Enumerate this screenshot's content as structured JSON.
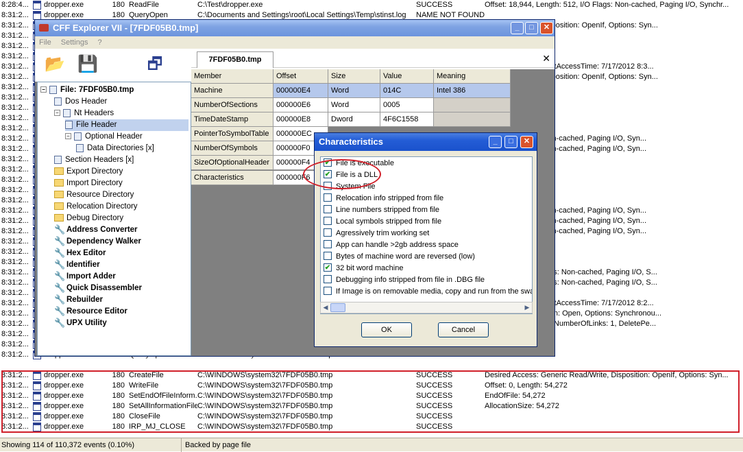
{
  "procmon": {
    "bg_rows": [
      {
        "time": "8:28:4...",
        "proc": "dropper.exe",
        "pid": "180",
        "op": "ReadFile",
        "path": "C:\\Test\\dropper.exe",
        "res": "SUCCESS",
        "det": "Offset: 18,944, Length: 512, I/O Flags: Non-cached, Paging I/O, Synchr..."
      },
      {
        "time": "8:31:2...",
        "proc": "dropper.exe",
        "pid": "180",
        "op": "QueryOpen",
        "path": "C:\\Documents and Settings\\root\\Local Settings\\Temp\\stinst.log",
        "res": "NAME NOT FOUND",
        "det": ""
      },
      {
        "time": "8:31:2...",
        "det": "eric Read/Write, Disposition: OpenIf, Options: Syn..."
      },
      {
        "time": "8:31:2...",
        "det": ""
      },
      {
        "time": "8:31:2...",
        "det": ""
      },
      {
        "time": "8:31:2...",
        "det": ""
      },
      {
        "time": "8:31:2...",
        "det": "012 8:31:28 PM, LastAccessTime: 7/17/2012 8:3..."
      },
      {
        "time": "8:31:2...",
        "det": "eric Read/Write, Disposition: OpenIf, Options: Syn..."
      },
      {
        "time": "8:31:2...",
        "det": ""
      },
      {
        "time": "8:31:2...",
        "det": ""
      },
      {
        "time": "8:31:2...",
        "det": ""
      },
      {
        "time": "8:31:2...",
        "det": ""
      },
      {
        "time": "8:31:2...",
        "det": ""
      },
      {
        "time": "8:31:2...",
        "det": "4,096, I/O Flags: Non-cached, Paging I/O, Syn..."
      },
      {
        "time": "8:31:2...",
        "det": "4,096, I/O Flags: Non-cached, Paging I/O, Syn..."
      },
      {
        "time": "8:31:2...",
        "det": ""
      },
      {
        "time": "8:31:2...",
        "det": ""
      },
      {
        "time": "8:31:2...",
        "det": ""
      },
      {
        "time": "8:31:2...",
        "det": ""
      },
      {
        "time": "8:31:2...",
        "det": ""
      },
      {
        "time": "8:31:2...",
        "det": "4,096, I/O Flags: Non-cached, Paging I/O, Syn..."
      },
      {
        "time": "8:31:2...",
        "det": "4,096, I/O Flags: Non-cached, Paging I/O, Syn..."
      },
      {
        "time": "8:31:2...",
        "det": "4,096, I/O Flags: Non-cached, Paging I/O, Syn..."
      },
      {
        "time": "8:31:2...",
        "det": ""
      },
      {
        "time": "8:31:2...",
        "det": ""
      },
      {
        "time": "8:31:2...",
        "det": ""
      },
      {
        "time": "8:31:2...",
        "det": "ngth: 4,096, I/O Flags: Non-cached, Paging I/O, S..."
      },
      {
        "time": "8:31:2...",
        "det": "ngth: 4,096, I/O Flags: Non-cached, Paging I/O, S..."
      },
      {
        "time": "8:31:2...",
        "det": ""
      },
      {
        "time": "8:31:2...",
        "det": "012 8:26:13 PM, LastAccessTime: 7/17/2012 8:2..."
      },
      {
        "time": "8:31:2...",
        "det": "eric Read, Disposition: Open, Options: Synchronou..."
      },
      {
        "time": "8:31:2...",
        "det": ", EndOfFile: 54,272, NumberOfLinks: 1, DeletePe..."
      },
      {
        "time": "8:31:2...",
        "det": "272"
      },
      {
        "time": "8:31:2...",
        "det": ""
      },
      {
        "time": "8:31:2...",
        "proc": "dropper.exe",
        "pid": "180",
        "op": "QueryOpen",
        "path": "C:\\WINDOWS\\system32\\7FDF05B0.tmp",
        "res": "NAME NOT FOUND",
        "det": ""
      }
    ],
    "red_rows": [
      {
        "time": "8:31:2...",
        "proc": "dropper.exe",
        "pid": "180",
        "op": "CreateFile",
        "path": "C:\\WINDOWS\\system32\\7FDF05B0.tmp",
        "res": "SUCCESS",
        "det": "Desired Access: Generic Read/Write, Disposition: OpenIf, Options: Syn..."
      },
      {
        "time": "8:31:2...",
        "proc": "dropper.exe",
        "pid": "180",
        "op": "WriteFile",
        "path": "C:\\WINDOWS\\system32\\7FDF05B0.tmp",
        "res": "SUCCESS",
        "det": "Offset: 0, Length: 54,272"
      },
      {
        "time": "8:31:2...",
        "proc": "dropper.exe",
        "pid": "180",
        "op": "SetEndOfFileInform...",
        "path": "C:\\WINDOWS\\system32\\7FDF05B0.tmp",
        "res": "SUCCESS",
        "det": "EndOfFile: 54,272"
      },
      {
        "time": "8:31:2...",
        "proc": "dropper.exe",
        "pid": "180",
        "op": "SetAllInformationFile",
        "path": "C:\\WINDOWS\\system32\\7FDF05B0.tmp",
        "res": "SUCCESS",
        "det": "AllocationSize: 54,272"
      },
      {
        "time": "8:31:2...",
        "proc": "dropper.exe",
        "pid": "180",
        "op": "CloseFile",
        "path": "C:\\WINDOWS\\system32\\7FDF05B0.tmp",
        "res": "SUCCESS",
        "det": ""
      },
      {
        "time": "8:31:2...",
        "proc": "dropper.exe",
        "pid": "180",
        "op": "IRP_MJ_CLOSE",
        "path": "C:\\WINDOWS\\system32\\7FDF05B0.tmp",
        "res": "SUCCESS",
        "det": ""
      }
    ],
    "status_left": "Showing 114 of 110,372 events (0.10%)",
    "status_right": "Backed by page file"
  },
  "cff": {
    "title": "CFF Explorer VII - [7FDF05B0.tmp]",
    "menu": [
      "File",
      "Settings",
      "?"
    ],
    "tab_label": "7FDF05B0.tmp",
    "tree": [
      {
        "label": "File: 7FDF05B0.tmp",
        "kind": "root"
      },
      {
        "label": "Dos Header",
        "kind": "doc"
      },
      {
        "label": "Nt Headers",
        "kind": "doc"
      },
      {
        "label": "File Header",
        "kind": "doc"
      },
      {
        "label": "Optional Header",
        "kind": "doc"
      },
      {
        "label": "Data Directories [x]",
        "kind": "doc"
      },
      {
        "label": "Section Headers [x]",
        "kind": "doc"
      },
      {
        "label": "Export Directory",
        "kind": "folder"
      },
      {
        "label": "Import Directory",
        "kind": "folder"
      },
      {
        "label": "Resource Directory",
        "kind": "folder"
      },
      {
        "label": "Relocation Directory",
        "kind": "folder"
      },
      {
        "label": "Debug Directory",
        "kind": "folder"
      },
      {
        "label": "Address Converter",
        "kind": "tool"
      },
      {
        "label": "Dependency Walker",
        "kind": "tool"
      },
      {
        "label": "Hex Editor",
        "kind": "tool"
      },
      {
        "label": "Identifier",
        "kind": "tool"
      },
      {
        "label": "Import Adder",
        "kind": "tool"
      },
      {
        "label": "Quick Disassembler",
        "kind": "tool"
      },
      {
        "label": "Rebuilder",
        "kind": "tool"
      },
      {
        "label": "Resource Editor",
        "kind": "tool"
      },
      {
        "label": "UPX Utility",
        "kind": "tool"
      }
    ],
    "grid_headers": [
      "Member",
      "Offset",
      "Size",
      "Value",
      "Meaning"
    ],
    "grid_rows": [
      [
        "Machine",
        "000000E4",
        "Word",
        "014C",
        "Intel 386"
      ],
      [
        "NumberOfSections",
        "000000E6",
        "Word",
        "0005",
        ""
      ],
      [
        "TimeDateStamp",
        "000000E8",
        "Dword",
        "4F6C1558",
        ""
      ],
      [
        "PointerToSymbolTable",
        "000000EC",
        "",
        "",
        ""
      ],
      [
        "NumberOfSymbols",
        "000000F0",
        "",
        "",
        ""
      ],
      [
        "SizeOfOptionalHeader",
        "000000F4",
        "",
        "",
        ""
      ],
      [
        "Characteristics",
        "000000F6",
        "",
        "",
        ""
      ]
    ]
  },
  "dialog": {
    "title": "Characteristics",
    "items": [
      {
        "label": "File is executable",
        "checked": true
      },
      {
        "label": "File is a DLL",
        "checked": true
      },
      {
        "label": "System File",
        "checked": false
      },
      {
        "label": "Relocation info stripped from file",
        "checked": false
      },
      {
        "label": "Line numbers stripped from file",
        "checked": false
      },
      {
        "label": "Local symbols stripped from file",
        "checked": false
      },
      {
        "label": "Agressively trim working set",
        "checked": false
      },
      {
        "label": "App can handle >2gb address space",
        "checked": false
      },
      {
        "label": "Bytes of machine word are reversed (low)",
        "checked": false
      },
      {
        "label": "32 bit word machine",
        "checked": true
      },
      {
        "label": "Debugging info stripped from file in .DBG file",
        "checked": false
      },
      {
        "label": "If Image is on removable media, copy and run from the swa",
        "checked": false
      }
    ],
    "ok": "OK",
    "cancel": "Cancel"
  }
}
